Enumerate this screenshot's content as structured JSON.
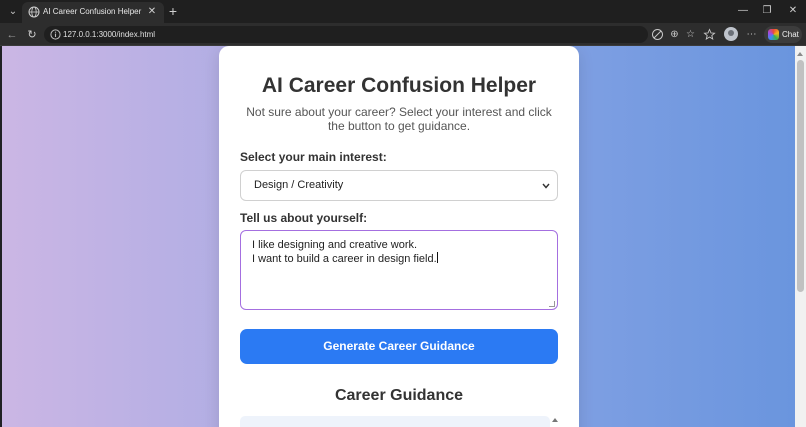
{
  "browser": {
    "tab_title": "AI Career Confusion Helper",
    "url": "127.0.0.1:3000/index.html",
    "chat_label": "Chat",
    "new_tab_symbol": "+",
    "close_symbol": "✕",
    "menu_symbol": "⌄",
    "window_controls": {
      "minimize": "—",
      "restore": "❐",
      "close": "✕"
    },
    "nav": {
      "back": "←",
      "reload": "↻"
    },
    "toolbar_icons": {
      "more": "⋯",
      "favorite": "☆",
      "zoom": "⊕"
    }
  },
  "page": {
    "title": "AI Career Confusion Helper",
    "subtitle": "Not sure about your career? Select your interest and click the button to get guidance.",
    "interest_label": "Select your main interest:",
    "interest_selected": "Design / Creativity",
    "about_label": "Tell us about yourself:",
    "about_text_line1": "I like designing and creative work.",
    "about_text_line2": "I want to build a career in design field.",
    "generate_button": "Generate Career Guidance",
    "guidance_title": "Career Guidance"
  }
}
